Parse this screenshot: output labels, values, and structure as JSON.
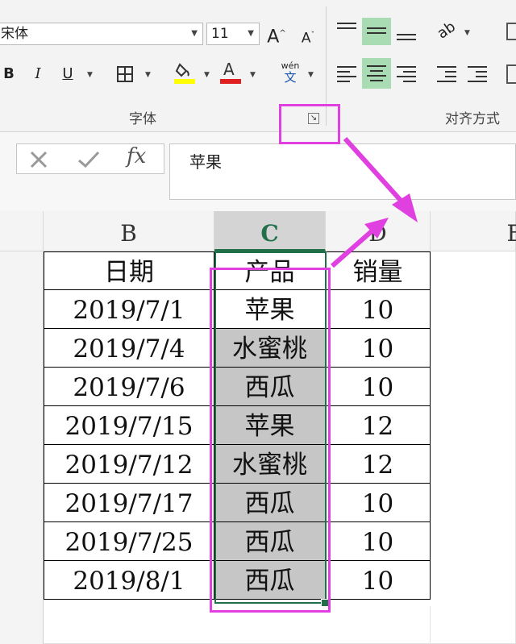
{
  "ribbon": {
    "font_name": "宋体",
    "font_size": "11",
    "grow_font_label": "A",
    "shrink_font_label": "A",
    "bold_label": "B",
    "italic_label": "I",
    "underline_label": "U",
    "phonetic_top": "wén",
    "phonetic_bottom": "文",
    "font_color_label": "A",
    "font_group_label": "字体",
    "align_group_label": "对齐方式",
    "colors": {
      "highlight": "#ffff00",
      "font_color": "#e02020",
      "active_align": "#a9dcb3"
    }
  },
  "formula_bar": {
    "cancel_icon": "cross-icon",
    "enter_icon": "check-icon",
    "function_label": "fx",
    "value": "苹果"
  },
  "columns": {
    "b": "B",
    "c": "C",
    "d": "D",
    "e": "E"
  },
  "table": {
    "headers": [
      "日期",
      "产品",
      "销量"
    ],
    "rows": [
      [
        "2019/7/1",
        "苹果",
        "10"
      ],
      [
        "2019/7/4",
        "水蜜桃",
        "10"
      ],
      [
        "2019/7/6",
        "西瓜",
        "10"
      ],
      [
        "2019/7/15",
        "苹果",
        "12"
      ],
      [
        "2019/7/12",
        "水蜜桃",
        "12"
      ],
      [
        "2019/7/17",
        "西瓜",
        "10"
      ],
      [
        "2019/7/25",
        "西瓜",
        "10"
      ],
      [
        "2019/8/1",
        "西瓜",
        "10"
      ]
    ]
  },
  "annotation_color": "#e040e0"
}
